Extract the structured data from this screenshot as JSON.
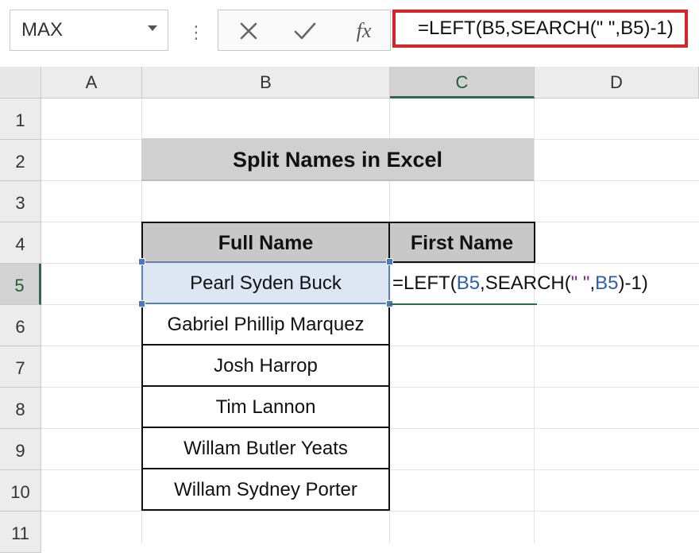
{
  "name_box": {
    "value": "MAX"
  },
  "formula_bar": {
    "separator": "⋮",
    "fx_label": "fx",
    "formula": "=LEFT(B5,SEARCH(\" \",B5)-1)"
  },
  "columns": [
    "A",
    "B",
    "C",
    "D"
  ],
  "active_column": "C",
  "rows": [
    "1",
    "2",
    "3",
    "4",
    "5",
    "6",
    "7",
    "8",
    "9",
    "10",
    "11"
  ],
  "active_row": "5",
  "sheet": {
    "title": "Split Names in Excel",
    "headers": {
      "full_name": "Full Name",
      "first_name": "First Name"
    },
    "full_names": [
      "Pearl Syden Buck",
      "Gabriel Phillip Marquez",
      "Josh Harrop",
      "Tim Lannon",
      "Willam Butler Yeats",
      "Willam Sydney Porter"
    ],
    "editing_cell": {
      "address": "C5",
      "formula_parts": [
        "=LEFT(",
        "B5",
        ",SEARCH(",
        "\" \"",
        ",",
        "B5",
        ")-1)"
      ]
    }
  },
  "colors": {
    "formula_highlight": "#d8232a",
    "active_header_accent": "#217346",
    "reference_color": "#2f5ea8",
    "selection_fill": "#dde6f3"
  }
}
